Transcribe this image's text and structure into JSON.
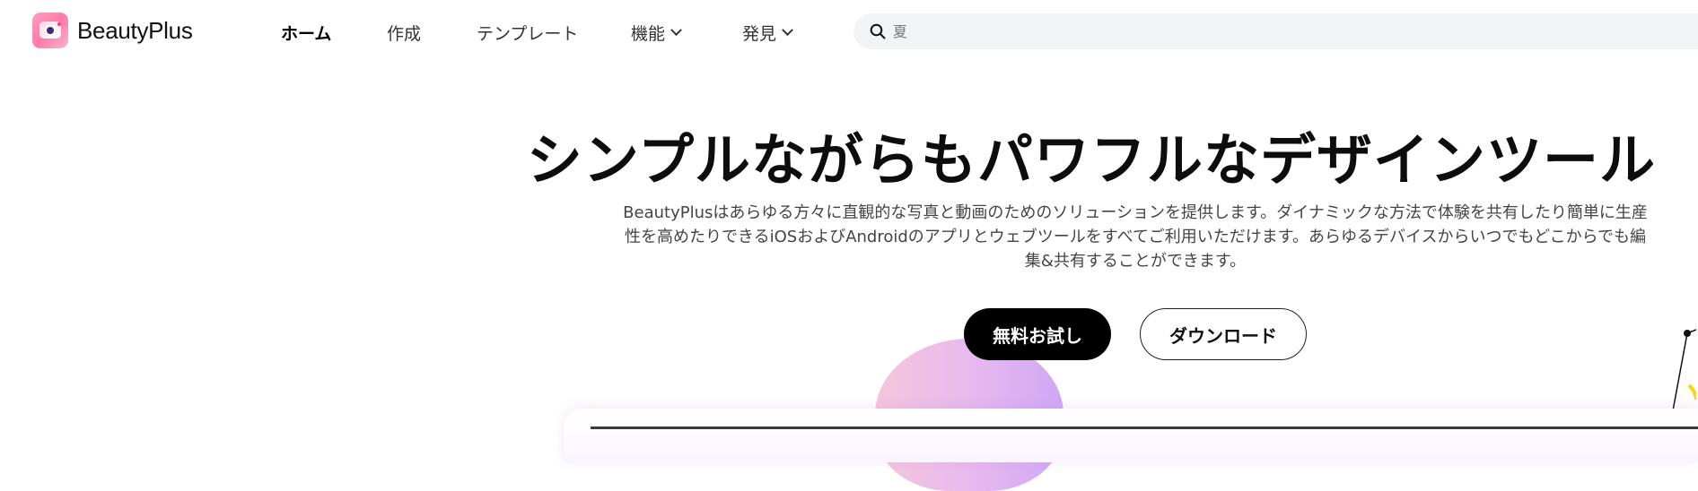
{
  "brand": {
    "name": "BeautyPlus"
  },
  "nav": {
    "items": [
      {
        "label": "ホーム",
        "active": true,
        "dropdown": false
      },
      {
        "label": "作成",
        "active": false,
        "dropdown": false
      },
      {
        "label": "テンプレート",
        "active": false,
        "dropdown": false
      },
      {
        "label": "機能",
        "active": false,
        "dropdown": true
      },
      {
        "label": "発見",
        "active": false,
        "dropdown": true
      }
    ]
  },
  "search": {
    "placeholder": "夏",
    "icon": "search-icon"
  },
  "hero": {
    "title": "シンプルながらもパワフルなデザインツール",
    "description": "BeautyPlusはあらゆる方々に直観的な写真と動画のためのソリューションを提供します。ダイナミックな方法で体験を共有したり簡単に生産性を高めたりできるiOSおよびAndroidのアプリとウェブツールをすべてご利用いただけます。あらゆるデバイスからいつでもどこからでも編集&共有することができます。",
    "primary_button": "無料お試し",
    "secondary_button": "ダウンロード"
  },
  "colors": {
    "primary": "#000000",
    "search_bg": "#f2f3f5",
    "accent_pink": "#ff7aa8"
  }
}
